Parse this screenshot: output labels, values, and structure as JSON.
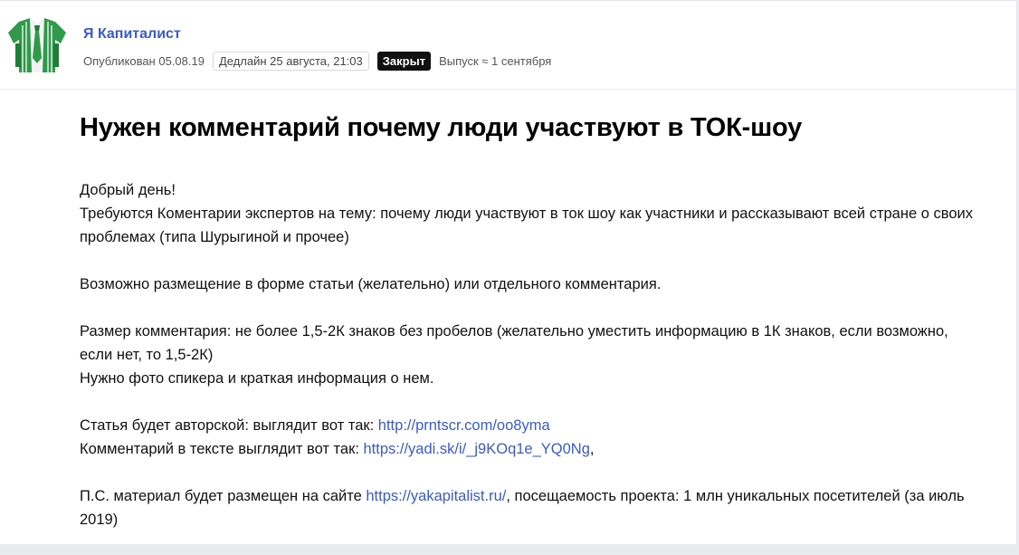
{
  "header": {
    "source_name": "Я Капиталист",
    "published": "Опубликован 05.08.19",
    "deadline": "Дедлайн 25 августа, 21:03",
    "status_badge": "Закрыт",
    "release": "Выпуск ≈ 1 сентября",
    "logo_icon": "shirt-tie-logo-icon"
  },
  "article": {
    "title": "Нужен комментарий почему люди участвуют в ТОК-шоу",
    "greeting": "Добрый день!",
    "p1": "Требуются Коментарии экспертов на тему: почему люди участвуют в ток шоу как участники и рассказывают всей стране о своих проблемах (типа Шурыгиной и прочее)",
    "p2": "Возможно размещение в форме статьи (желательно) или отдельного комментария.",
    "p3": "Размер комментария: не более 1,5-2К знаков без пробелов (желательно уместить информацию в 1К знаков, если возможно, если нет, то 1,5-2К)",
    "p4": "Нужно фото спикера и краткая информация о нем.",
    "author_label": "Статья будет авторской: выглядит вот так: ",
    "author_link": "http://prntscr.com/oo8yma",
    "comment_label": "Комментарий в тексте выглядит вот так: ",
    "comment_link": "https://yadi.sk/i/_j9KOq1e_YQ0Ng",
    "comment_suffix": ",",
    "ps_label": "П.С. материал будет размещен на сайте ",
    "ps_link": "https://yakapitalist.ru/",
    "ps_suffix": ", посещаемость проекта: 1 млн уникальных посетителей (за июль 2019)"
  },
  "colors": {
    "link": "#3a5bc7",
    "badge_bg": "#111111",
    "logo_green": "#2e9a4a"
  }
}
